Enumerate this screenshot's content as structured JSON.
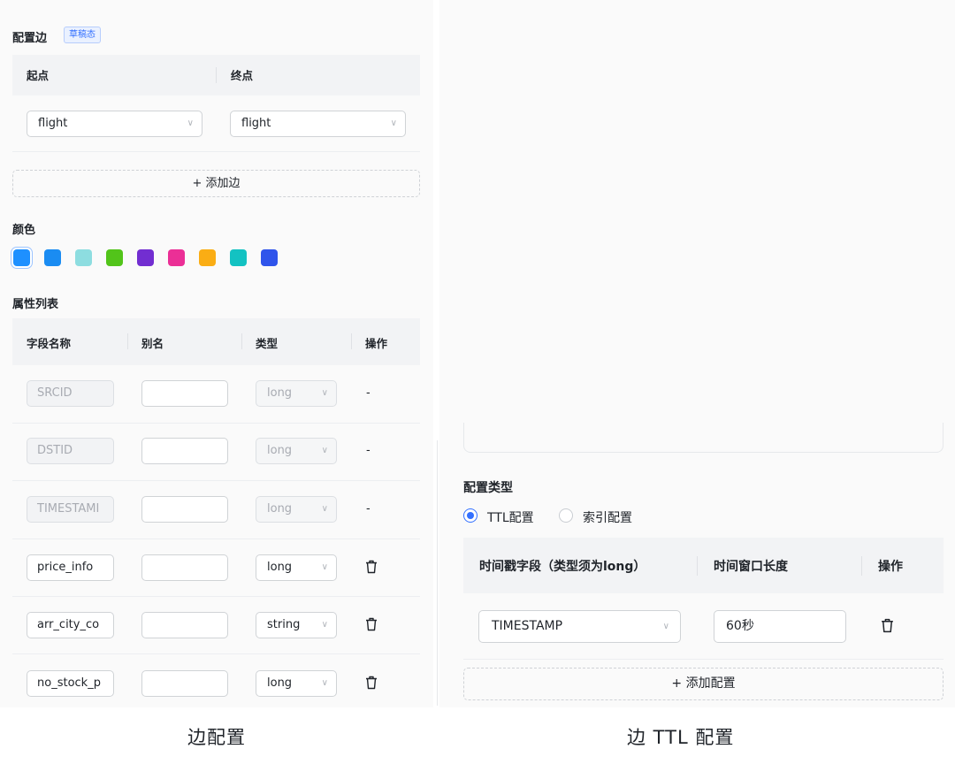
{
  "edge_config": {
    "title": "配置边",
    "badge": "草稿态",
    "table_headers": {
      "from": "起点",
      "to": "终点"
    },
    "from_value": "flight",
    "to_value": "flight",
    "add_edge_label": "+ 添加边"
  },
  "color": {
    "title": "颜色",
    "swatches": [
      "#1e90ff",
      "#1a8cf2",
      "#8ddde0",
      "#52c41a",
      "#722ed1",
      "#eb2f96",
      "#faad14",
      "#13c2c2",
      "#2f54eb"
    ],
    "selected_index": 0
  },
  "properties": {
    "title": "属性列表",
    "headers": {
      "field_name": "字段名称",
      "alias": "别名",
      "type": "类型",
      "action": "操作"
    },
    "rows": [
      {
        "field": "SRCID",
        "alias": "",
        "type": "long",
        "action": "-"
      },
      {
        "field": "DSTID",
        "alias": "",
        "type": "long",
        "action": "-"
      },
      {
        "field": "TIMESTAMI",
        "alias": "",
        "type": "long",
        "action": "-"
      },
      {
        "field": "price_info",
        "alias": "",
        "type": "long",
        "action": "delete-icon"
      },
      {
        "field": "arr_city_co",
        "alias": "",
        "type": "string",
        "action": "delete-icon"
      },
      {
        "field": "no_stock_p",
        "alias": "",
        "type": "long",
        "action": "delete-icon"
      }
    ]
  },
  "ttl_config": {
    "title": "配置类型",
    "options": [
      "TTL配置",
      "索引配置"
    ],
    "selected_option": 0,
    "headers": {
      "timestamp": "时间戳字段（类型须为long）",
      "window": "时间窗口长度",
      "action": "操作"
    },
    "timestamp_value": "TIMESTAMP",
    "window_value": "60秒",
    "add_config_label": "+ 添加配置"
  },
  "captions": {
    "left": "边配置",
    "right": "边 TTL 配置"
  }
}
